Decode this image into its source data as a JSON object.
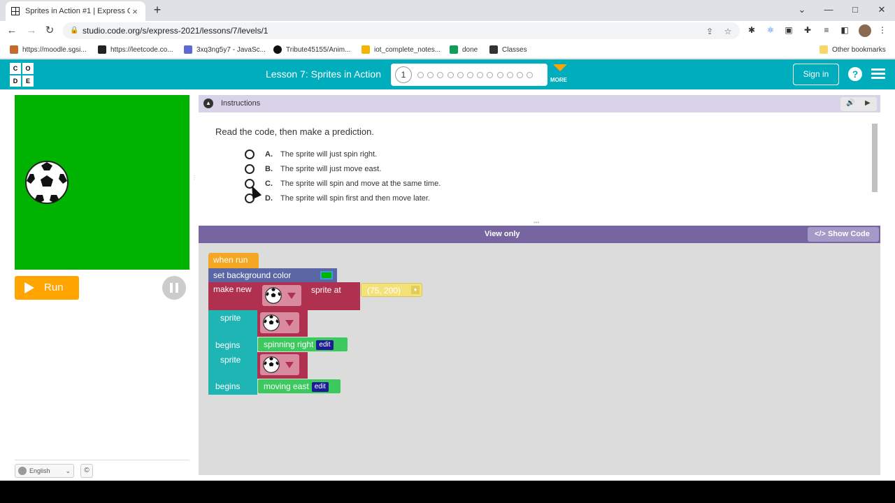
{
  "browser": {
    "tab_title": "Sprites in Action #1 | Express Cou",
    "tab_close": "×",
    "new_tab": "+",
    "url": "studio.code.org/s/express-2021/lessons/7/levels/1",
    "window_controls": {
      "chevron": "⌄",
      "minimize": "—",
      "maximize": "□",
      "close": "✕"
    },
    "nav": {
      "back": "←",
      "forward": "→",
      "reload": "↻"
    },
    "bookmarks": [
      {
        "label": "https://moodle.sgsi...",
        "color": "#c46a2c"
      },
      {
        "label": "https://leetcode.co...",
        "color": "#222222"
      },
      {
        "label": "3xq3ng5y7 - JavaSc...",
        "color": "#5d6ad6"
      },
      {
        "label": "Tribute45155/Anim...",
        "color": "#111111"
      },
      {
        "label": "iot_complete_notes...",
        "color": "#f4b400"
      },
      {
        "label": "done",
        "color": "#0f9d58"
      },
      {
        "label": "Classes",
        "color": "#333333"
      }
    ],
    "other_bookmarks": "Other bookmarks"
  },
  "header": {
    "logo_letters": [
      "C",
      "O",
      "D",
      "E"
    ],
    "lesson_title": "Lesson 7: Sprites in Action",
    "current_level": "1",
    "level_dots": 12,
    "more_label": "MORE",
    "signin_label": "Sign in",
    "help_label": "?"
  },
  "instructions": {
    "header_label": "Instructions",
    "collapse_glyph": "▲",
    "audio_icon": "🔊",
    "play_icon": "▶",
    "prompt": "Read the code, then make a prediction.",
    "choices": [
      {
        "letter": "A.",
        "text": "The sprite will just spin right."
      },
      {
        "letter": "B.",
        "text": "The sprite will just move east."
      },
      {
        "letter": "C.",
        "text": "The sprite will spin and move at the same time."
      },
      {
        "letter": "D.",
        "text": "The sprite will spin first and then move later."
      }
    ]
  },
  "left": {
    "run_label": "Run",
    "language": "English",
    "copyright": "©"
  },
  "workspace": {
    "view_only": "View only",
    "show_code": "Show Code",
    "show_code_icon": "</>",
    "blocks": {
      "when_run": "when run",
      "set_background": "set background color",
      "make_new": "make new",
      "sprite_at": "sprite at",
      "coords": "(75, 200)",
      "sprite_label": "sprite",
      "begins_label": "begins",
      "behavior_1": "spinning right",
      "behavior_2": "moving east",
      "edit_label": "edit"
    }
  },
  "colors": {
    "header_teal": "#00adbc",
    "stage_green": "#00b300",
    "run_orange": "#ffa400",
    "workspace_purple": "#7665a0"
  }
}
